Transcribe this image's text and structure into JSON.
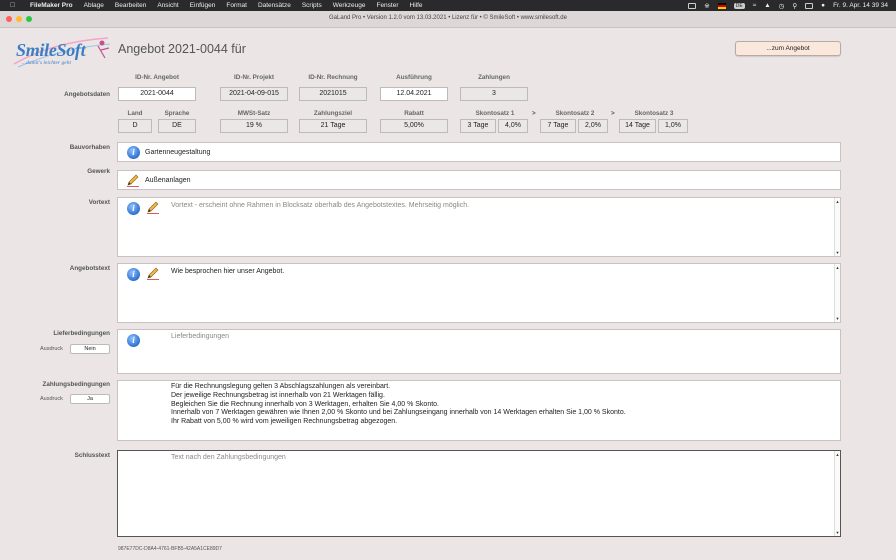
{
  "menubar": {
    "app_name": "FileMaker Pro",
    "items": [
      "Ablage",
      "Bearbeiten",
      "Ansicht",
      "Einfügen",
      "Format",
      "Datensätze",
      "Scripts",
      "Werkzeuge",
      "Fenster",
      "Hilfe"
    ],
    "clock": "Fr. 9. Apr. 14 39 34"
  },
  "window": {
    "title": "GaLand Pro • Version 1.2.0 vom 13.03.2021 • Lizenz für  • © SmileSoft • www.smilesoft.de"
  },
  "logo": {
    "name": "SmileSoft",
    "tagline": "...damit's leichter geht"
  },
  "header": {
    "title": "Angebot 2021-0044 für",
    "button": "...zum Angebot"
  },
  "angebotsdaten": {
    "row_label": "Angebotsdaten",
    "headers": {
      "id_angebot": "ID-Nr. Angebot",
      "id_projekt": "ID-Nr. Projekt",
      "id_rechnung": "ID-Nr. Rechnung",
      "ausfuehrung": "Ausführung",
      "zahlungen": "Zahlungen"
    },
    "values": {
      "id_angebot": "2021-0044",
      "id_projekt": "2021-04-09-015",
      "id_rechnung": "2021015",
      "ausfuehrung": "12.04.2021",
      "zahlungen": "3"
    }
  },
  "details": {
    "headers": {
      "land": "Land",
      "sprache": "Sprache",
      "mwst": "MWSt-Satz",
      "zahlungsziel": "Zahlungsziel",
      "rabatt": "Rabatt",
      "skonto1": "Skontosatz 1",
      "skonto2": "Skontosatz 2",
      "skonto3": "Skontosatz 3"
    },
    "values": {
      "land": "D",
      "sprache": "DE",
      "mwst": "19 %",
      "zahlungsziel": "21 Tage",
      "rabatt": "5,00%",
      "skonto1_tage": "3 Tage",
      "skonto1_satz": "4,0%",
      "skonto2_tage": "7 Tage",
      "skonto2_satz": "2,0%",
      "skonto3_tage": "14 Tage",
      "skonto3_satz": "1,0%"
    },
    "separator": ">"
  },
  "sections": {
    "bauvorhaben": {
      "label": "Bauvorhaben",
      "value": "Gartenneugestaltung"
    },
    "gewerk": {
      "label": "Gewerk",
      "value": "Außenanlagen"
    },
    "vortext": {
      "label": "Vortext",
      "placeholder": "Vortext - erscheint ohne Rahmen in Blocksatz oberhalb des Angebotstextes. Mehrseitig möglich."
    },
    "angebotstext": {
      "label": "Angebotstext",
      "value": "Wie besprochen hier unser Angebot."
    },
    "lieferbedingungen": {
      "label": "Lieferbedingungen",
      "placeholder": "Lieferbedingungen",
      "ausdruck_label": "Ausdruck",
      "ausdruck_value": "Nein"
    },
    "zahlungsbedingungen": {
      "label": "Zahlungsbedingungen",
      "ausdruck_label": "Ausdruck",
      "ausdruck_value": "Ja",
      "lines": [
        "Für die Rechnungslegung gelten 3 Abschlagszahlungen als vereinbart.",
        "Der jeweilige Rechnungsbetrag ist innerhalb von 21 Werktagen fällig.",
        "Begleichen Sie die Rechnung innerhalb von 3 Werktagen, erhalten Sie 4,00 % Skonto.",
        "Innerhalb von 7 Werktagen gewähren wie Ihnen 2,00 % Skonto und bei Zahlungseingang innerhalb von 14 Werktagen erhalten Sie 1,00 % Skonto.",
        "Ihr Rabatt von 5,00 % wird vom jeweiligen Rechnungsbetrag abgezogen."
      ]
    },
    "schlusstext": {
      "label": "Schlusstext",
      "placeholder": "Text nach den Zahlungsbedingungen"
    }
  },
  "record_id": "987E77DC-D8A4-4761-BFB5-42A5A1CE89D7",
  "icons": {
    "info": "info-icon",
    "edit": "pencil-icon"
  }
}
